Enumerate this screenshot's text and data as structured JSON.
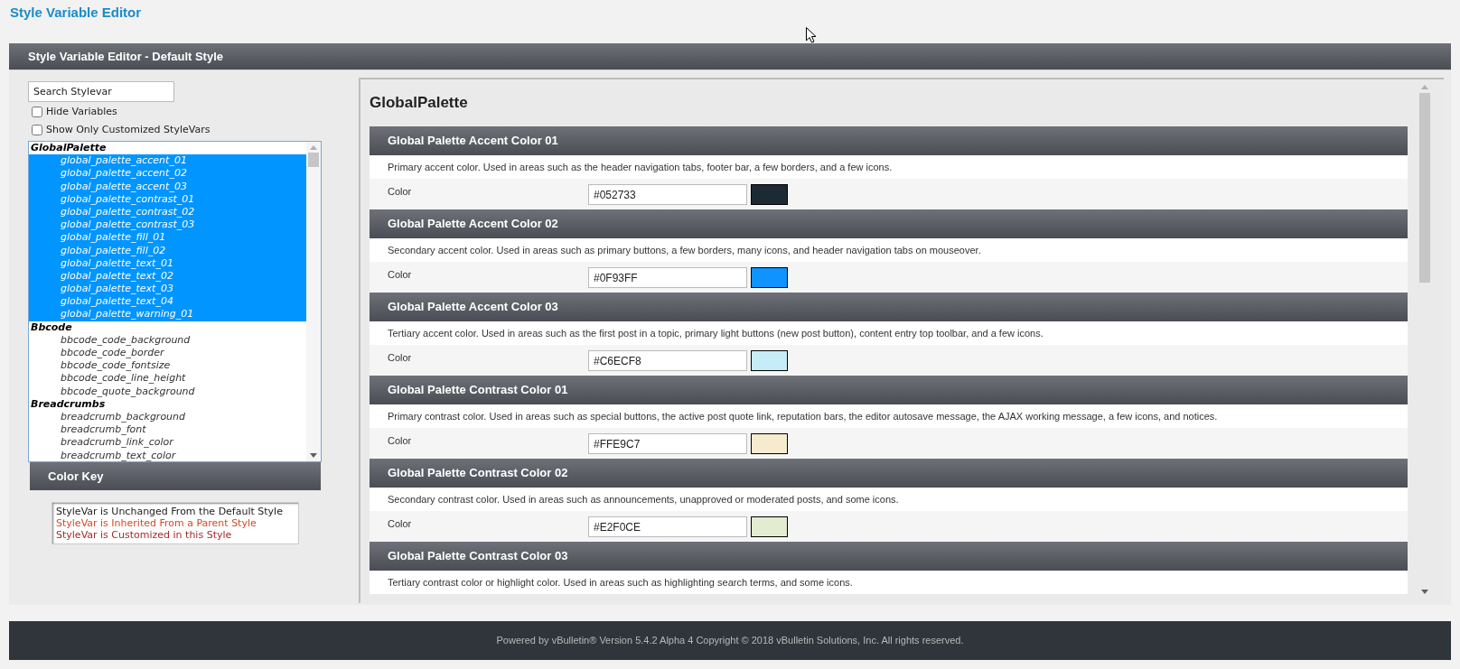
{
  "page_title": "Style Variable Editor",
  "panel": {
    "title": "Style Variable Editor - Default Style"
  },
  "search": {
    "placeholder": "Search Stylevar"
  },
  "options": [
    {
      "label": "Hide Variables",
      "checked": false
    },
    {
      "label": "Show Only Customized StyleVars",
      "checked": false
    }
  ],
  "stylevar_list": [
    {
      "label": "GlobalPalette",
      "children": [
        {
          "label": "global_palette_accent_01",
          "selected": true
        },
        {
          "label": "global_palette_accent_02",
          "selected": true
        },
        {
          "label": "global_palette_accent_03",
          "selected": true
        },
        {
          "label": "global_palette_contrast_01",
          "selected": true
        },
        {
          "label": "global_palette_contrast_02",
          "selected": true
        },
        {
          "label": "global_palette_contrast_03",
          "selected": true
        },
        {
          "label": "global_palette_fill_01",
          "selected": true
        },
        {
          "label": "global_palette_fill_02",
          "selected": true
        },
        {
          "label": "global_palette_text_01",
          "selected": true
        },
        {
          "label": "global_palette_text_02",
          "selected": true
        },
        {
          "label": "global_palette_text_03",
          "selected": true
        },
        {
          "label": "global_palette_text_04",
          "selected": true
        },
        {
          "label": "global_palette_warning_01",
          "selected": true
        }
      ]
    },
    {
      "label": "Bbcode",
      "children": [
        {
          "label": "bbcode_code_background",
          "selected": false
        },
        {
          "label": "bbcode_code_border",
          "selected": false
        },
        {
          "label": "bbcode_code_fontsize",
          "selected": false
        },
        {
          "label": "bbcode_code_line_height",
          "selected": false
        },
        {
          "label": "bbcode_quote_background",
          "selected": false
        }
      ]
    },
    {
      "label": "Breadcrumbs",
      "children": [
        {
          "label": "breadcrumb_background",
          "selected": false
        },
        {
          "label": "breadcrumb_font",
          "selected": false
        },
        {
          "label": "breadcrumb_link_color",
          "selected": false
        },
        {
          "label": "breadcrumb_text_color",
          "selected": false
        }
      ]
    }
  ],
  "color_key": {
    "title": "Color Key",
    "items": [
      {
        "label": "StyleVar is Unchanged From the Default Style",
        "color": "#222222"
      },
      {
        "label": "StyleVar is Inherited From a Parent Style",
        "color": "#d2492a"
      },
      {
        "label": "StyleVar is Customized in this Style",
        "color": "#a52a2a"
      }
    ]
  },
  "editor": {
    "group_title": "GlobalPalette",
    "sections": [
      {
        "title": "Global Palette Accent Color 01",
        "description": "Primary accent color. Used in areas such as the header navigation tabs, footer bar, a few borders, and a few icons.",
        "field_label": "Color",
        "value": "#052733",
        "color": "#1c2a33"
      },
      {
        "title": "Global Palette Accent Color 02",
        "description": "Secondary accent color. Used in areas such as primary buttons, a few borders, many icons, and header navigation tabs on mouseover.",
        "field_label": "Color",
        "value": "#0F93FF",
        "color": "#0f93ff"
      },
      {
        "title": "Global Palette Accent Color 03",
        "description": "Tertiary accent color. Used in areas such as the first post in a topic, primary light buttons (new post button), content entry top toolbar, and a few icons.",
        "field_label": "Color",
        "value": "#C6ECF8",
        "color": "#c6ecf8"
      },
      {
        "title": "Global Palette Contrast Color 01",
        "description": "Primary contrast color. Used in areas such as special buttons, the active post quote link, reputation bars, the editor autosave message, the AJAX working message, a few icons, and notices.",
        "field_label": "Color",
        "value": "#FFE9C7",
        "color": "#f7ebcf"
      },
      {
        "title": "Global Palette Contrast Color 02",
        "description": "Secondary contrast color. Used in areas such as announcements, unapproved or moderated posts, and some icons.",
        "field_label": "Color",
        "value": "#E2F0CE",
        "color": "#e2ecd0"
      },
      {
        "title": "Global Palette Contrast Color 03",
        "description": "Tertiary contrast color or highlight color. Used in areas such as highlighting search terms, and some icons."
      }
    ]
  },
  "footer": "Powered by vBulletin® Version 5.4.2 Alpha 4 Copyright © 2018 vBulletin Solutions, Inc. All rights reserved."
}
